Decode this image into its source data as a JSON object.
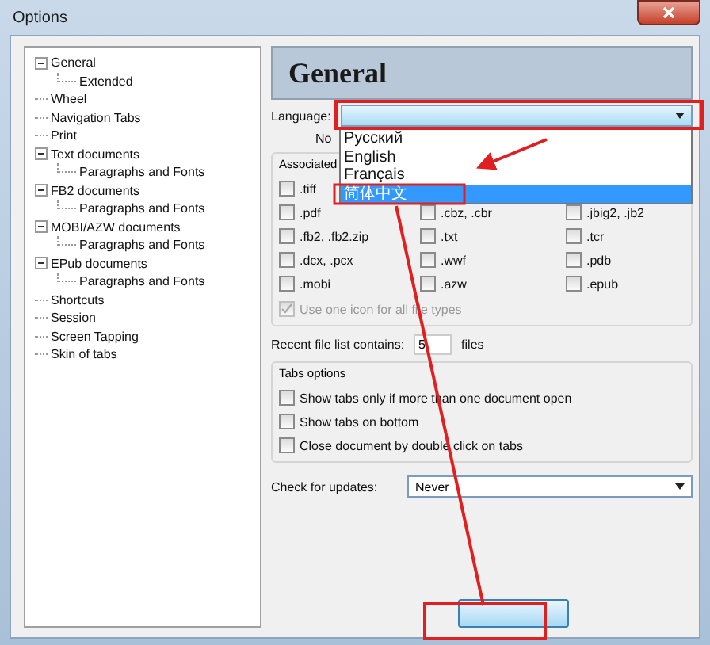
{
  "window": {
    "title": "Options"
  },
  "tree": [
    {
      "label": "General",
      "expanded": true,
      "children": [
        {
          "label": "Extended"
        }
      ]
    },
    {
      "label": "Wheel"
    },
    {
      "label": "Navigation Tabs"
    },
    {
      "label": "Print"
    },
    {
      "label": "Text documents",
      "expanded": true,
      "children": [
        {
          "label": "Paragraphs and Fonts"
        }
      ]
    },
    {
      "label": "FB2 documents",
      "expanded": true,
      "children": [
        {
          "label": "Paragraphs and Fonts"
        }
      ]
    },
    {
      "label": "MOBI/AZW documents",
      "expanded": true,
      "children": [
        {
          "label": "Paragraphs and Fonts"
        }
      ]
    },
    {
      "label": "EPub documents",
      "expanded": true,
      "children": [
        {
          "label": "Paragraphs and Fonts"
        }
      ]
    },
    {
      "label": "Shortcuts"
    },
    {
      "label": "Session"
    },
    {
      "label": "Screen Tapping"
    },
    {
      "label": "Skin of tabs"
    }
  ],
  "page": {
    "title": "General",
    "language": {
      "label": "Language:",
      "open": true,
      "options": [
        {
          "label": "Русский",
          "selected": false
        },
        {
          "label": "English",
          "selected": false
        },
        {
          "label": "Français",
          "selected": false
        },
        {
          "label": "简体中文",
          "selected": true
        }
      ]
    },
    "note": "No",
    "file_group": {
      "title": "Associated",
      "items": [
        {
          "label": ".tiff",
          "checked": false
        },
        {
          "label": ".pdf",
          "checked": false
        },
        {
          "label": ".cbz, .cbr",
          "checked": false
        },
        {
          "label": ".jbig2, .jb2",
          "checked": false
        },
        {
          "label": ".fb2, .fb2.zip",
          "checked": false
        },
        {
          "label": ".txt",
          "checked": false
        },
        {
          "label": ".tcr",
          "checked": false
        },
        {
          "label": ".dcx, .pcx",
          "checked": false
        },
        {
          "label": ".wwf",
          "checked": false
        },
        {
          "label": ".pdb",
          "checked": false
        },
        {
          "label": ".mobi",
          "checked": false
        },
        {
          "label": ".azw",
          "checked": false
        },
        {
          "label": ".epub",
          "checked": false
        }
      ],
      "use_one_icon": {
        "label": "Use one icon for all file types",
        "checked": true,
        "disabled": true
      }
    },
    "recent": {
      "label": "Recent file list contains:",
      "value": "5",
      "suffix": "files"
    },
    "tabs_options": {
      "title": "Tabs options",
      "items": [
        {
          "label": "Show tabs only if more than one document open",
          "checked": false
        },
        {
          "label": "Show tabs on bottom",
          "checked": false
        },
        {
          "label": "Close document by double click on tabs",
          "checked": false
        }
      ]
    },
    "updates": {
      "label": "Check for updates:",
      "value": "Never"
    }
  }
}
